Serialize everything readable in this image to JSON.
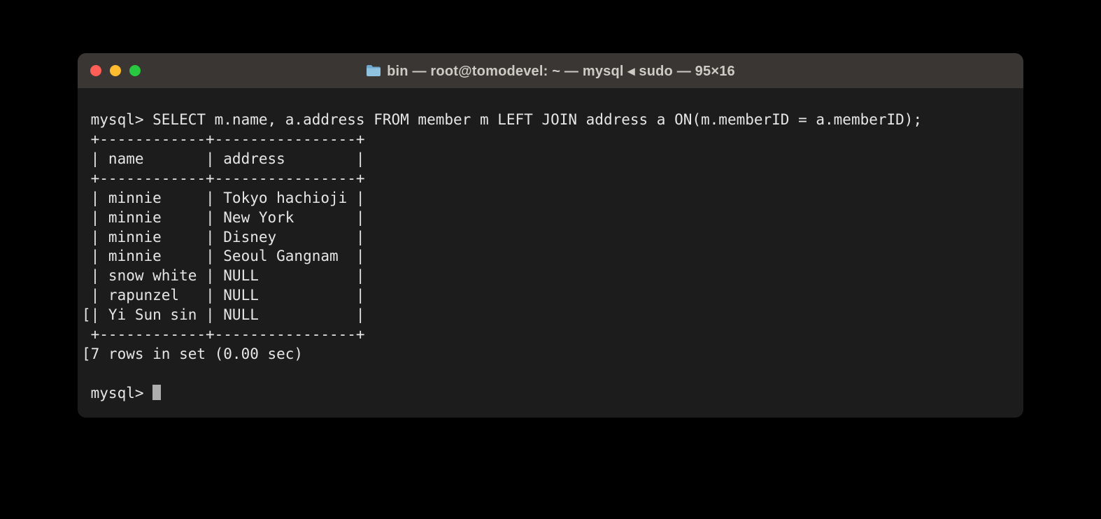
{
  "window": {
    "title": "bin — root@tomodevel: ~ — mysql ◂ sudo — 95×16"
  },
  "terminal": {
    "prompt": "mysql>",
    "query": "SELECT m.name, a.address FROM member m LEFT JOIN address a ON(m.memberID = a.memberID);",
    "columns": {
      "col1": "name",
      "col2": "address",
      "col1_width": 12,
      "col2_width": 16
    },
    "rows": [
      {
        "name": "minnie",
        "address": "Tokyo hachioji",
        "bracket": false
      },
      {
        "name": "minnie",
        "address": "New York",
        "bracket": false
      },
      {
        "name": "minnie",
        "address": "Disney",
        "bracket": false
      },
      {
        "name": "minnie",
        "address": "Seoul Gangnam",
        "bracket": false
      },
      {
        "name": "snow white",
        "address": "NULL",
        "bracket": false
      },
      {
        "name": "rapunzel",
        "address": "NULL",
        "bracket": false
      },
      {
        "name": "Yi Sun sin",
        "address": "NULL",
        "bracket": true
      }
    ],
    "footer": "7 rows in set (0.00 sec)",
    "footer_bracket": true
  }
}
